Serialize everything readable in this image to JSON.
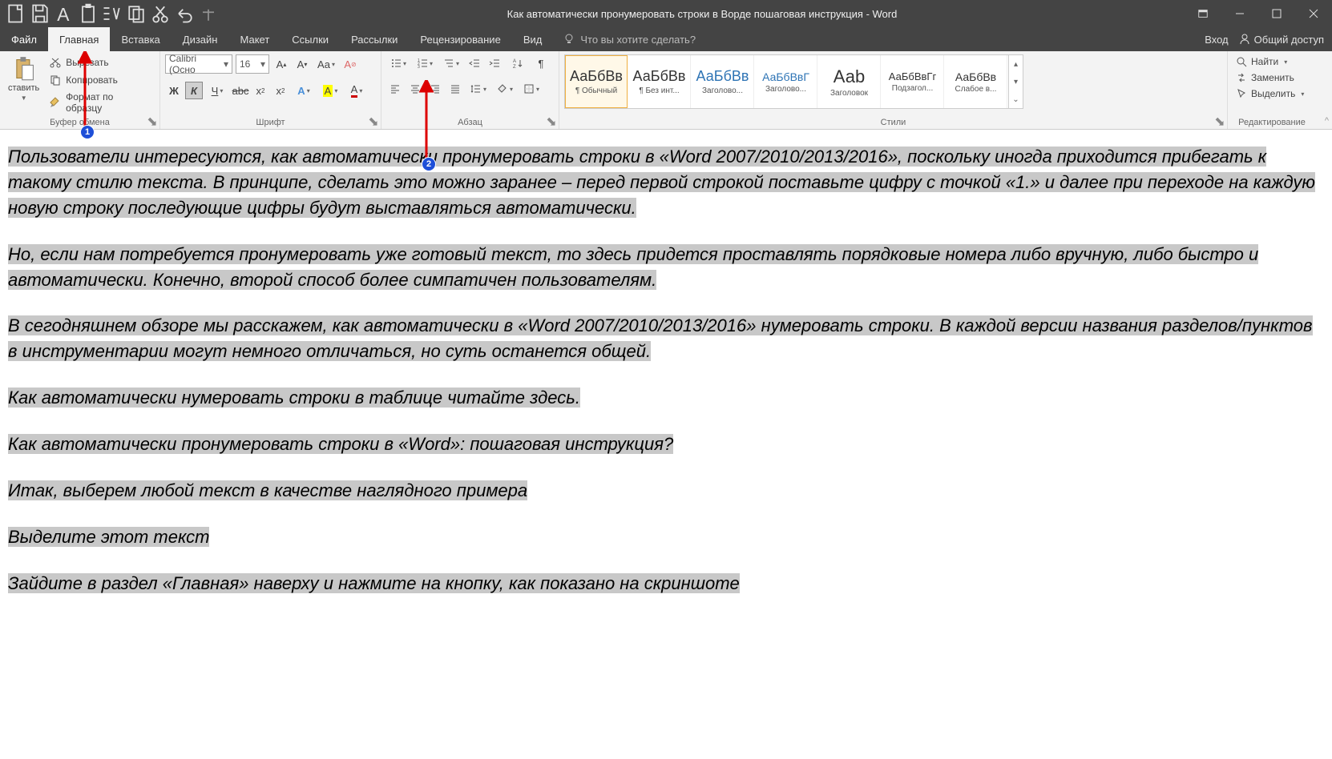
{
  "title": "Как автоматически пронумеровать строки в Ворде пошаговая инструкция - Word",
  "tabs": {
    "file": "Файл",
    "home": "Главная",
    "insert": "Вставка",
    "design": "Дизайн",
    "layout": "Макет",
    "references": "Ссылки",
    "mailings": "Рассылки",
    "review": "Рецензирование",
    "view": "Вид"
  },
  "tellme": "Что вы хотите сделать?",
  "signin": "Вход",
  "share": "Общий доступ",
  "clipboard": {
    "paste": "ставить",
    "cut": "Вырезать",
    "copy": "Копировать",
    "format": "Формат по образцу",
    "label": "Буфер обмена"
  },
  "font": {
    "name": "Calibri (Осно",
    "size": "16",
    "label": "Шрифт"
  },
  "para": {
    "label": "Абзац"
  },
  "styles": {
    "label": "Стили",
    "items": [
      {
        "preview": "АаБбВв",
        "label": "¶ Обычный",
        "cls": ""
      },
      {
        "preview": "АаБбВв",
        "label": "¶ Без инт...",
        "cls": ""
      },
      {
        "preview": "АаБбВв",
        "label": "Заголово...",
        "cls": "blue"
      },
      {
        "preview": "АаБбВвГ",
        "label": "Заголово...",
        "cls": "blue mid"
      },
      {
        "preview": "Ааb",
        "label": "Заголовок",
        "cls": "big"
      },
      {
        "preview": "АаБбВвГг",
        "label": "Подзагол...",
        "cls": "sm"
      },
      {
        "preview": "АаБбВв",
        "label": "Слабое в...",
        "cls": "mid"
      }
    ]
  },
  "editing": {
    "find": "Найти",
    "replace": "Заменить",
    "select": "Выделить",
    "label": "Редактирование"
  },
  "doc": {
    "p1": "Пользователи интересуются, как автоматически пронумеровать строки в «Word 2007/2010/2013/2016», поскольку иногда приходится прибегать к такому стилю текста. В принципе, сделать это можно заранее – перед первой строкой поставьте цифру с точкой «1.» и далее при переходе на каждую новую строку последующие цифры будут выставляться автоматически.",
    "p2": "Но, если нам потребуется пронумеровать уже готовый текст, то здесь придется проставлять порядковые номера либо вручную, либо быстро и автоматически. Конечно, второй способ более симпатичен пользователям.",
    "p3": "В сегодняшнем обзоре мы расскажем, как автоматически в «Word 2007/2010/2013/2016» нумеровать строки. В каждой версии названия разделов/пунктов в инструментарии могут немного отличаться, но суть останется общей.",
    "p4": "Как автоматически нумеровать строки в таблице читайте здесь.",
    "p5": "Как автоматически пронумеровать строки в «Word»: пошаговая инструкция?",
    "p6": "Итак, выберем любой текст в качестве наглядного примера",
    "p7": "Выделите этот текст",
    "p8": "Зайдите в раздел «Главная» наверху и нажмите на кнопку, как показано на скриншоте"
  },
  "badges": {
    "one": "1",
    "two": "2"
  }
}
